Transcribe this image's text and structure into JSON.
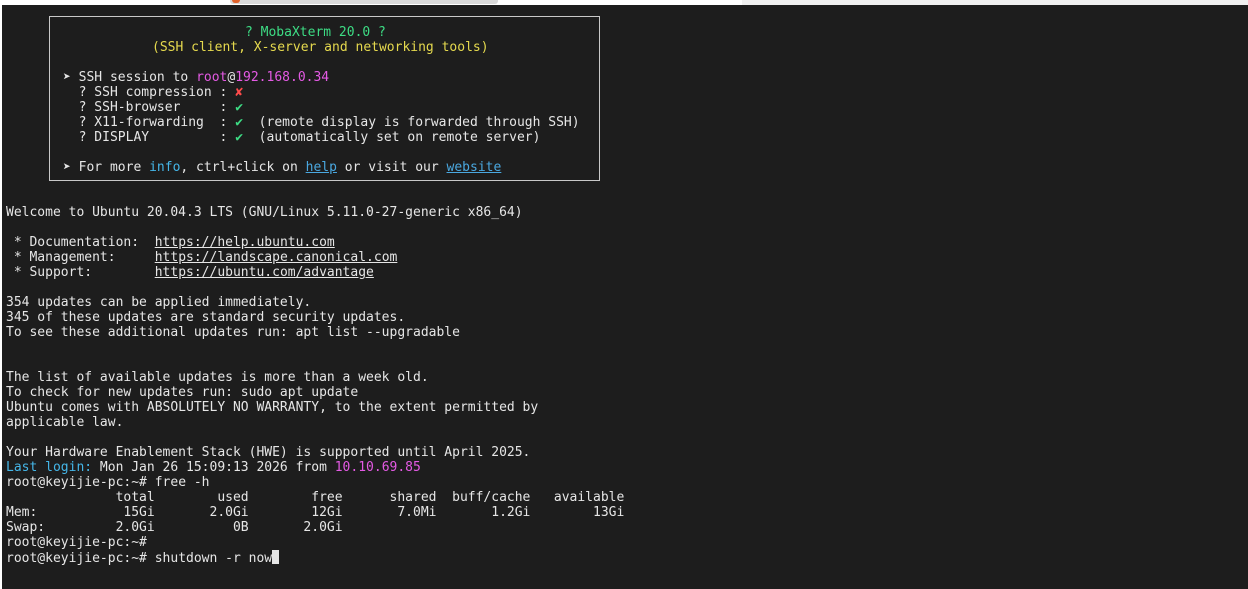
{
  "banner": {
    "title": "? MobaXterm 20.0 ?",
    "subtitle": "(SSH client, X-server and networking tools)",
    "session_prefix": "➤ SSH session to ",
    "session_user": "root",
    "session_at": "@",
    "session_host": "192.168.0.34",
    "compression_label": "  ? SSH compression : ",
    "compression_value": "✘",
    "browser_label": "  ? SSH-browser     : ",
    "browser_value": "✔",
    "x11_label": "  ? X11-forwarding  : ",
    "x11_value": "✔",
    "x11_note": "  (remote display is forwarded through SSH)",
    "display_label": "  ? DISPLAY         : ",
    "display_value": "✔",
    "display_note": "  (automatically set on remote server)",
    "more_prefix": "➤ For more ",
    "more_info": "info",
    "more_mid": ", ctrl+click on ",
    "more_help": "help",
    "more_or": " or visit our ",
    "more_website": "website"
  },
  "motd": {
    "welcome": "Welcome to Ubuntu 20.04.3 LTS (GNU/Linux 5.11.0-27-generic x86_64)",
    "doc_label": " * Documentation:  ",
    "doc_url": "https://help.ubuntu.com",
    "mgmt_label": " * Management:     ",
    "mgmt_url": "https://landscape.canonical.com",
    "support_label": " * Support:        ",
    "support_url": "https://ubuntu.com/advantage",
    "updates_1": "354 updates can be applied immediately.",
    "updates_2": "345 of these updates are standard security updates.",
    "updates_3": "To see these additional updates run: apt list --upgradable",
    "list_1": "The list of available updates is more than a week old.",
    "list_2": "To check for new updates run: sudo apt update",
    "warranty_1": "Ubuntu comes with ABSOLUTELY NO WARRANTY, to the extent permitted by",
    "warranty_2": "applicable law.",
    "hwe": "Your Hardware Enablement Stack (HWE) is supported until April 2025.",
    "last_login_label": "Last login:",
    "last_login_value": " Mon Jan 26 15:09:13 2026 from ",
    "last_login_host": "10.10.69.85"
  },
  "session": {
    "prompt": "root@keyijie-pc:~# ",
    "cmd_free": "free -h",
    "free_header": "              total        used        free      shared  buff/cache   available",
    "free_mem": "Mem:           15Gi       2.0Gi        12Gi       7.0Mi       1.2Gi        13Gi",
    "free_swap": "Swap:         2.0Gi          0B       2.0Gi",
    "cmd_shutdown": "shutdown -r now"
  }
}
